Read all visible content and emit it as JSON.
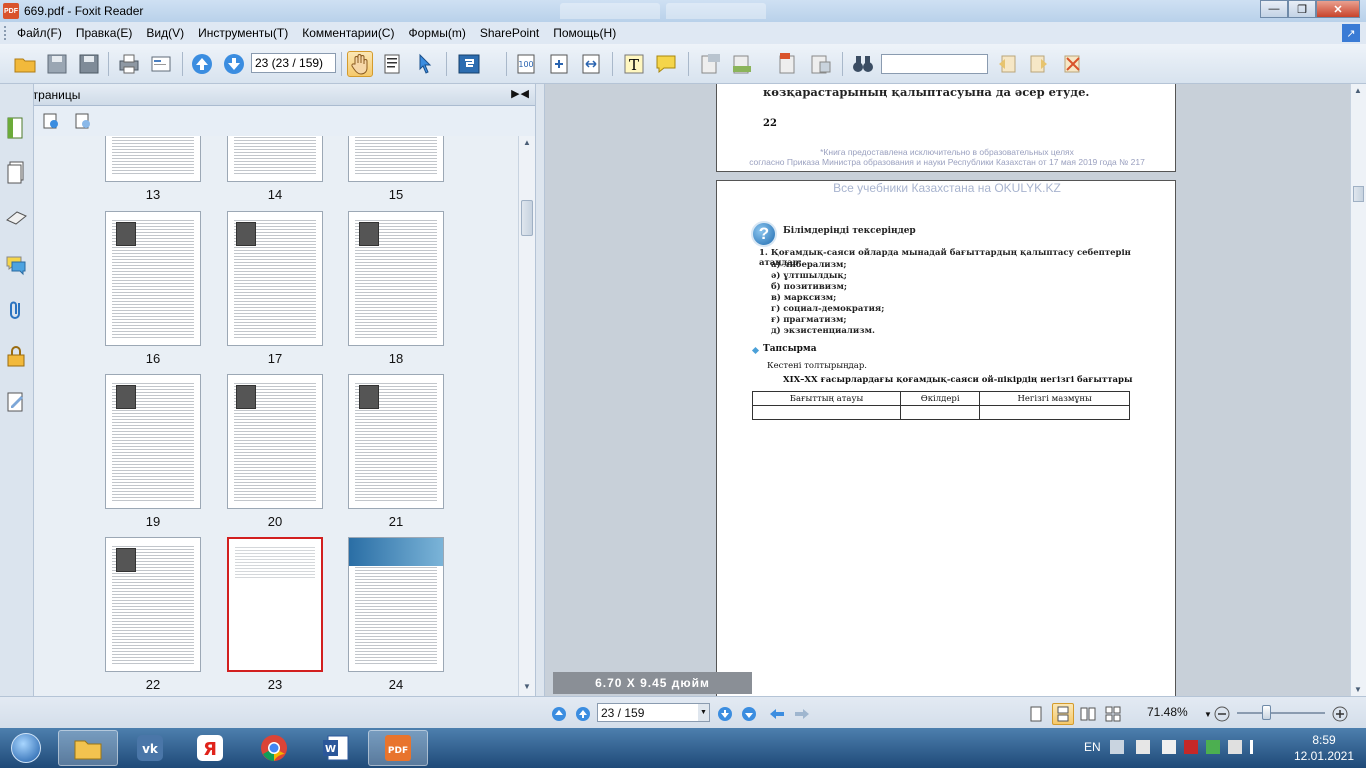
{
  "window": {
    "app_icon_label": "PDF",
    "title": "669.pdf - Foxit Reader"
  },
  "menu": [
    "Файл(F)",
    "Правка(E)",
    "Вид(V)",
    "Инструменты(T)",
    "Комментарии(C)",
    "Формы(m)",
    "SharePoint",
    "Помощь(H)"
  ],
  "toolbar": {
    "page_field": "23 (23 / 159)",
    "search_value": ""
  },
  "panel": {
    "title": "Страницы",
    "thumbnails": [
      "13",
      "14",
      "15",
      "16",
      "17",
      "18",
      "19",
      "20",
      "21",
      "22",
      "23",
      "24"
    ],
    "selected": "23"
  },
  "document": {
    "prev_page_line": "көзқарастарының қалыптасуына да әсер етуде.",
    "prev_page_number": "22",
    "footnote_1": "*Книга предоставлена исключительно в образовательных целях",
    "footnote_2": "согласно Приказа Министра образования и науки Республики Казахстан от 17 мая 2019 года № 217",
    "watermark": "Все учебники Казахстана на OKULYK.KZ",
    "question_icon": "?",
    "heading": "Білімдеріңді тексеріңдер",
    "question_1": "1. Қоғамдық-саяси ойларда мынадай бағыттардың қалыптасу себептерін атаңдар:",
    "options": [
      "а) либерализм;",
      "ә) ұлтшылдық;",
      "б) позитивизм;",
      "в) марксизм;",
      "г) социал-демократия;",
      "ғ) прагматизм;",
      "д) экзистенциализм."
    ],
    "task_title": "Тапсырма",
    "task_sub": "Кестені толтырыңдар.",
    "table_title": "XIX–XX ғасырлардағы қоғамдық-саяси ой-пікірдің негізгі бағыттары",
    "table_headers": [
      "Бағыттың атауы",
      "Өкілдері",
      "Негізгі мазмұны"
    ],
    "page_size": "6.70 X 9.45 дюйм"
  },
  "statusbar": {
    "page_field": "23 / 159",
    "zoom": "71.48%"
  },
  "taskbar": {
    "lang": "EN",
    "time": "8:59",
    "date": "12.01.2021"
  },
  "colors": {
    "accent": "#d9532c",
    "selection": "#d21f1f",
    "watermark": "#a8b4cf"
  }
}
